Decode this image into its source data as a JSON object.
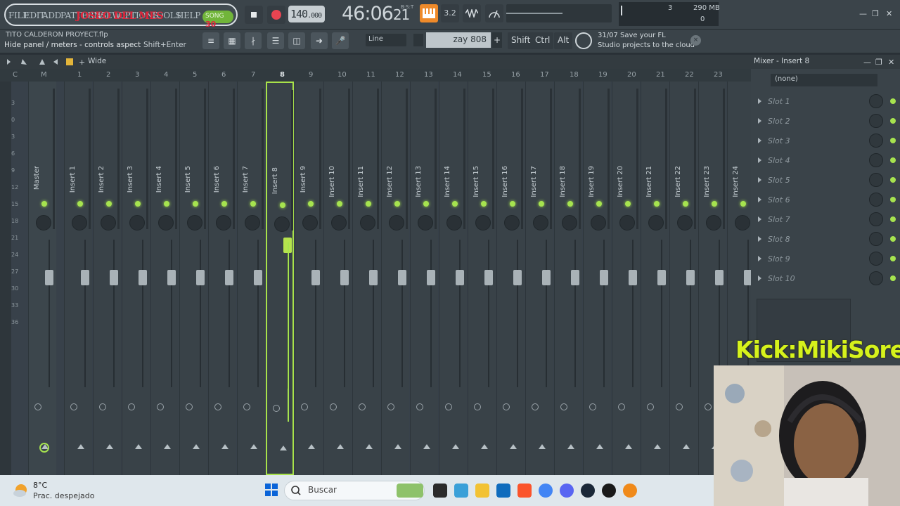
{
  "topbar": {
    "menu": [
      "FILE",
      "EDIT",
      "ADD",
      "PATTERNS",
      "VIEW",
      "OPTIONS",
      "TOOLS",
      "HELP"
    ],
    "overlay_text": "JOSEO DEL MES",
    "song_label": "SONG",
    "song_mode": "30",
    "tempo": "140",
    "tempo_decimal": ".000",
    "time": "46:06",
    "time_sub": "21",
    "time_unit": "B:S:T",
    "pattern_icon": "piano-roll-icon",
    "cpu_voices": "3",
    "cpu_memory": "290 MB",
    "cpu_poly": "0"
  },
  "toolbar": {
    "project_file": "TITO CALDERON PROYECT.flp",
    "hint": "Hide panel / meters - controls aspect",
    "hint_shortcut": "Shift+Enter",
    "snap": "Line",
    "pattern_name": "zay 808",
    "pattern_add": "+",
    "modifier_keys": [
      "Shift",
      "Ctrl",
      "Alt"
    ],
    "news_count": "31/07",
    "news_line1": "Save your FL",
    "news_line2": "Studio projects to the cloud",
    "news_close": "×"
  },
  "mixer": {
    "view": "Wide",
    "title": "Mixer - Insert 8",
    "ruler": [
      "C",
      "M",
      "1",
      "2",
      "3",
      "4",
      "5",
      "6",
      "7",
      "8",
      "9",
      "10",
      "11",
      "12",
      "13",
      "14",
      "15",
      "16",
      "17",
      "18",
      "19",
      "20",
      "21",
      "22",
      "23"
    ],
    "selected_index": 9,
    "tracks": [
      "Master",
      "Insert 1",
      "Insert 2",
      "Insert 3",
      "Insert 4",
      "Insert 5",
      "Insert 6",
      "Insert 7",
      "Insert 8",
      "Insert 9",
      "Insert 10",
      "Insert 11",
      "Insert 12",
      "Insert 13",
      "Insert 14",
      "Insert 15",
      "Insert 16",
      "Insert 17",
      "Insert 18",
      "Insert 19",
      "Insert 20",
      "Insert 21",
      "Insert 22",
      "Insert 23",
      "Insert 24"
    ],
    "db_scale": [
      "3",
      "0",
      "3",
      "6",
      "9",
      "12",
      "15",
      "18",
      "21",
      "24",
      "27",
      "30",
      "33",
      "36"
    ]
  },
  "right_panel": {
    "preset": "(none)",
    "slots": [
      "Slot 1",
      "Slot 2",
      "Slot 3",
      "Slot 4",
      "Slot 5",
      "Slot 6",
      "Slot 7",
      "Slot 8",
      "Slot 9",
      "Slot 10"
    ]
  },
  "overlay": {
    "credit": "Kick:MikiSorel"
  },
  "taskbar": {
    "temperature": "8°C",
    "weather": "Prac. despejado",
    "search_placeholder": "Buscar",
    "accent": "#0a64d8"
  }
}
